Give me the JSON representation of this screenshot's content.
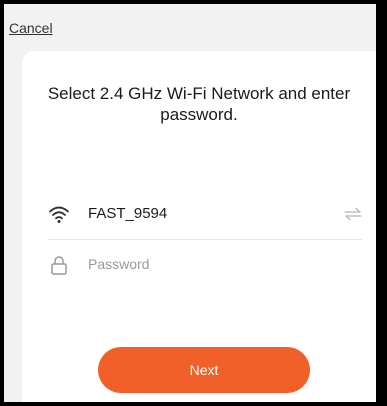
{
  "header": {
    "cancel_label": "Cancel"
  },
  "title": "Select 2.4 GHz Wi-Fi Network and enter password.",
  "wifi": {
    "icon": "wifi-icon",
    "ssid": "FAST_9594",
    "switch_icon": "switch-network-icon"
  },
  "password": {
    "icon": "lock-icon",
    "placeholder": "Password",
    "value": ""
  },
  "next_button": {
    "label": "Next",
    "color": "#f2602a"
  },
  "colors": {
    "screen_background": "#f2f2f2",
    "card_background": "#ffffff",
    "accent": "#f2602a"
  }
}
